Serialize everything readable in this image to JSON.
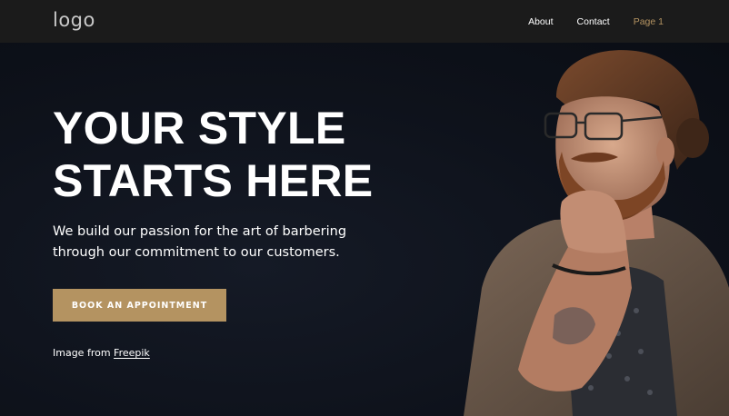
{
  "header": {
    "logo": "logo",
    "nav": [
      {
        "label": "About",
        "active": false
      },
      {
        "label": "Contact",
        "active": false
      },
      {
        "label": "Page 1",
        "active": true
      }
    ]
  },
  "hero": {
    "title_line1": "YOUR STYLE",
    "title_line2": "STARTS HERE",
    "subtitle": "We build our passion for the art of barbering through our commitment to our customers.",
    "cta_label": "BOOK AN APPOINTMENT",
    "credit_prefix": "Image from",
    "credit_link": "Freepik"
  },
  "colors": {
    "accent": "#b49361",
    "header_bg": "#1b1b1b",
    "hero_bg": "#0e121b",
    "text": "#ffffff"
  },
  "icons": [
    "portrait-photo"
  ]
}
